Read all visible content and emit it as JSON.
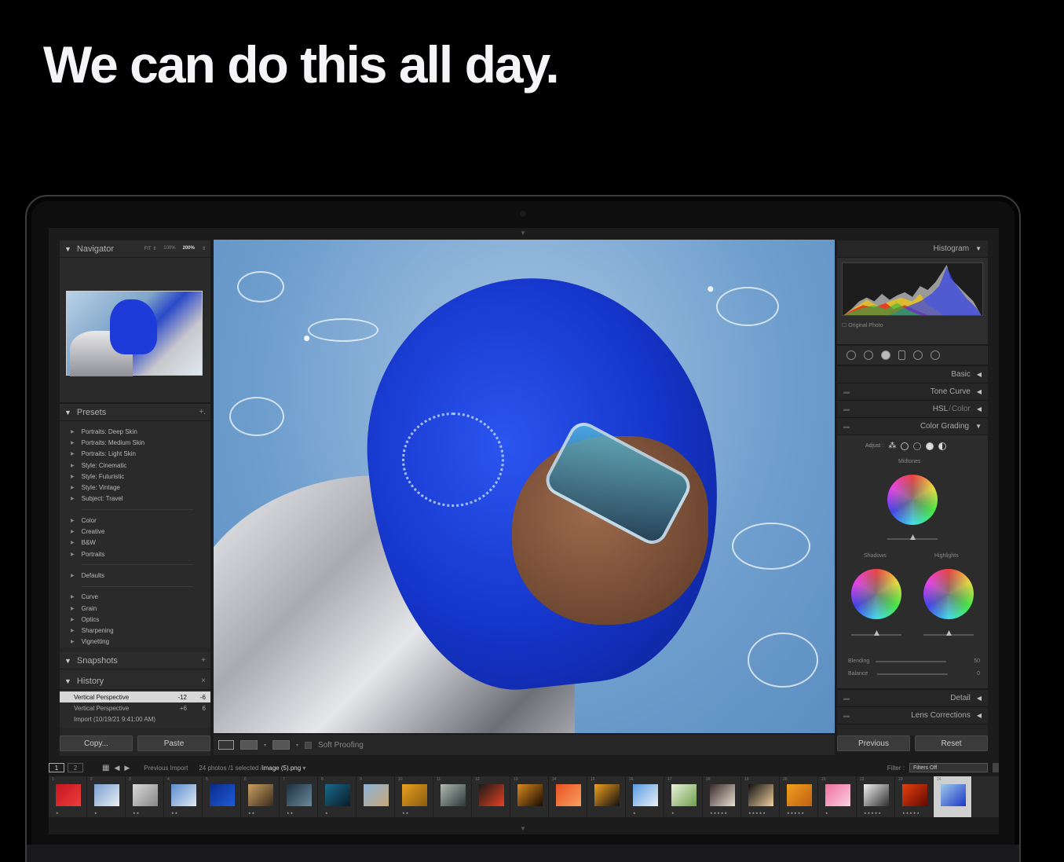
{
  "headline": "We can do this all day.",
  "navigator": {
    "title": "Navigator",
    "zoom_fit": "FIT ⇕",
    "zoom_100": "100%",
    "zoom_200": "200%",
    "zoom_caret": "⇕"
  },
  "presets": {
    "title": "Presets",
    "add": "+.",
    "groups": [
      [
        "Portraits: Deep Skin",
        "Portraits: Medium Skin",
        "Portraits: Light Skin",
        "Style: Cinematic",
        "Style: Futuristic",
        "Style: Vintage",
        "Subject: Travel"
      ],
      [
        "Color",
        "Creative",
        "B&W",
        "Portraits"
      ],
      [
        "Defaults"
      ],
      [
        "Curve",
        "Grain",
        "Optics",
        "Sharpening",
        "Vignetting"
      ]
    ]
  },
  "snapshots": {
    "title": "Snapshots",
    "add": "+"
  },
  "history": {
    "title": "History",
    "close": "×",
    "items": [
      {
        "label": "Vertical Perspective",
        "v1": "-12",
        "v2": "-6"
      },
      {
        "label": "Vertical Perspective",
        "v1": "+6",
        "v2": "6"
      },
      {
        "label": "Import (10/19/21 9:41:00 AM)",
        "v1": "",
        "v2": ""
      }
    ]
  },
  "left_buttons": {
    "copy": "Copy...",
    "paste": "Paste"
  },
  "toolbar": {
    "soft_proofing": "Soft Proofing"
  },
  "right_panel": {
    "histogram": "Histogram",
    "original_photo": "Original Photo",
    "basic": "Basic",
    "tone_curve": "Tone Curve",
    "hsl": "HSL",
    "hsl_sep": "/",
    "hsl_color": "Color",
    "color_grading": "Color Grading",
    "adjust": "Adjust :",
    "midtones": "Midtones",
    "shadows": "Shadows",
    "highlights": "Highlights",
    "blending": "Blending",
    "blending_value": "50",
    "balance": "Balance",
    "balance_value": "0",
    "detail": "Detail",
    "lens_corrections": "Lens Corrections",
    "previous": "Previous",
    "reset": "Reset"
  },
  "filmbar": {
    "page1": "1",
    "page2": "2",
    "source": "Previous Import",
    "count": "24 photos /1 selected /",
    "filename": "image (5).png",
    "caret": "▾",
    "filter_label": "Filter :",
    "filter_value": "Filters Off"
  },
  "filmstrip": {
    "thumbs": [
      {
        "n": "1",
        "c1": "#c8141e",
        "c2": "#e84040",
        "stars": "★"
      },
      {
        "n": "2",
        "c1": "#7aa0d0",
        "c2": "#e8eef4",
        "stars": "★"
      },
      {
        "n": "3",
        "c1": "#d8d8d8",
        "c2": "#888",
        "stars": "★★"
      },
      {
        "n": "4",
        "c1": "#5a8ccc",
        "c2": "#dfe9f4",
        "stars": "★★"
      },
      {
        "n": "5",
        "c1": "#0a2a8a",
        "c2": "#1e5cd8",
        "stars": ""
      },
      {
        "n": "6",
        "c1": "#c8a060",
        "c2": "#3b2a1c",
        "stars": "★★"
      },
      {
        "n": "7",
        "c1": "#1c3040",
        "c2": "#6a8a9a",
        "stars": "★★"
      },
      {
        "n": "8",
        "c1": "#1a6a8a",
        "c2": "#0a1a2a",
        "stars": "★"
      },
      {
        "n": "9",
        "c1": "#8ab4d8",
        "c2": "#c8a878",
        "stars": ""
      },
      {
        "n": "10",
        "c1": "#e8a020",
        "c2": "#8a5a10",
        "stars": "★★"
      },
      {
        "n": "11",
        "c1": "#b0b8b0",
        "c2": "#2a3a3a",
        "stars": ""
      },
      {
        "n": "12",
        "c1": "#1a1a1a",
        "c2": "#e84020",
        "stars": ""
      },
      {
        "n": "13",
        "c1": "#d88a20",
        "c2": "#1a0a00",
        "stars": ""
      },
      {
        "n": "14",
        "c1": "#e85020",
        "c2": "#f8a060",
        "stars": ""
      },
      {
        "n": "15",
        "c1": "#f0a020",
        "c2": "#101010",
        "stars": ""
      },
      {
        "n": "16",
        "c1": "#5a9ae0",
        "c2": "#e8f0f8",
        "stars": "★"
      },
      {
        "n": "17",
        "c1": "#e8f0d8",
        "c2": "#70a050",
        "stars": "★"
      },
      {
        "n": "18",
        "c1": "#3a2a2a",
        "c2": "#e8e0d0",
        "stars": "★★★★★"
      },
      {
        "n": "19",
        "c1": "#101010",
        "c2": "#f0d0a0",
        "stars": "★★★★★"
      },
      {
        "n": "20",
        "c1": "#f0a020",
        "c2": "#c06010",
        "stars": "★★★★★"
      },
      {
        "n": "21",
        "c1": "#f070a0",
        "c2": "#f8d0e0",
        "stars": "★"
      },
      {
        "n": "22",
        "c1": "#f0f0f0",
        "c2": "#303030",
        "stars": "★★★★★"
      },
      {
        "n": "23",
        "c1": "#e84010",
        "c2": "#600a00",
        "stars": "★★★★★"
      },
      {
        "n": "24",
        "c1": "#a0c8e8",
        "c2": "#1838c8",
        "stars": ""
      }
    ]
  },
  "colors": {
    "hood_blue": "#1434c8",
    "sky_blue": "#6e9ecd",
    "panel_bg": "#262626"
  }
}
